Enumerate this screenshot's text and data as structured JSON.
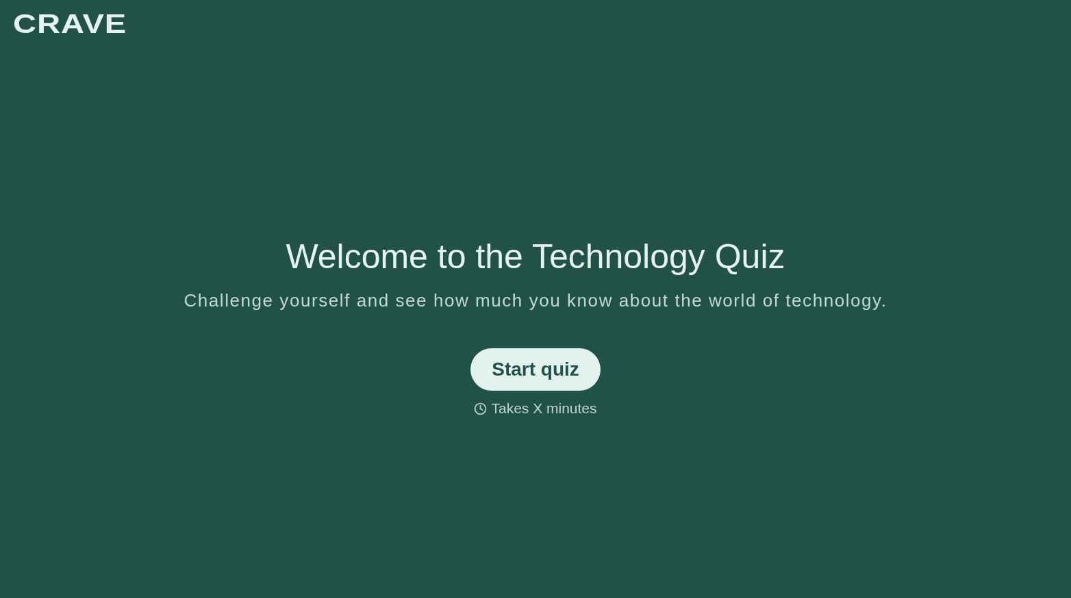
{
  "logo": {
    "text": "CRAVE"
  },
  "heading": "Welcome to the Technology Quiz",
  "subtitle": "Challenge yourself and see how much you know about the world of technology.",
  "start_button": {
    "label": "Start quiz"
  },
  "duration": {
    "text": "Takes X minutes"
  }
}
